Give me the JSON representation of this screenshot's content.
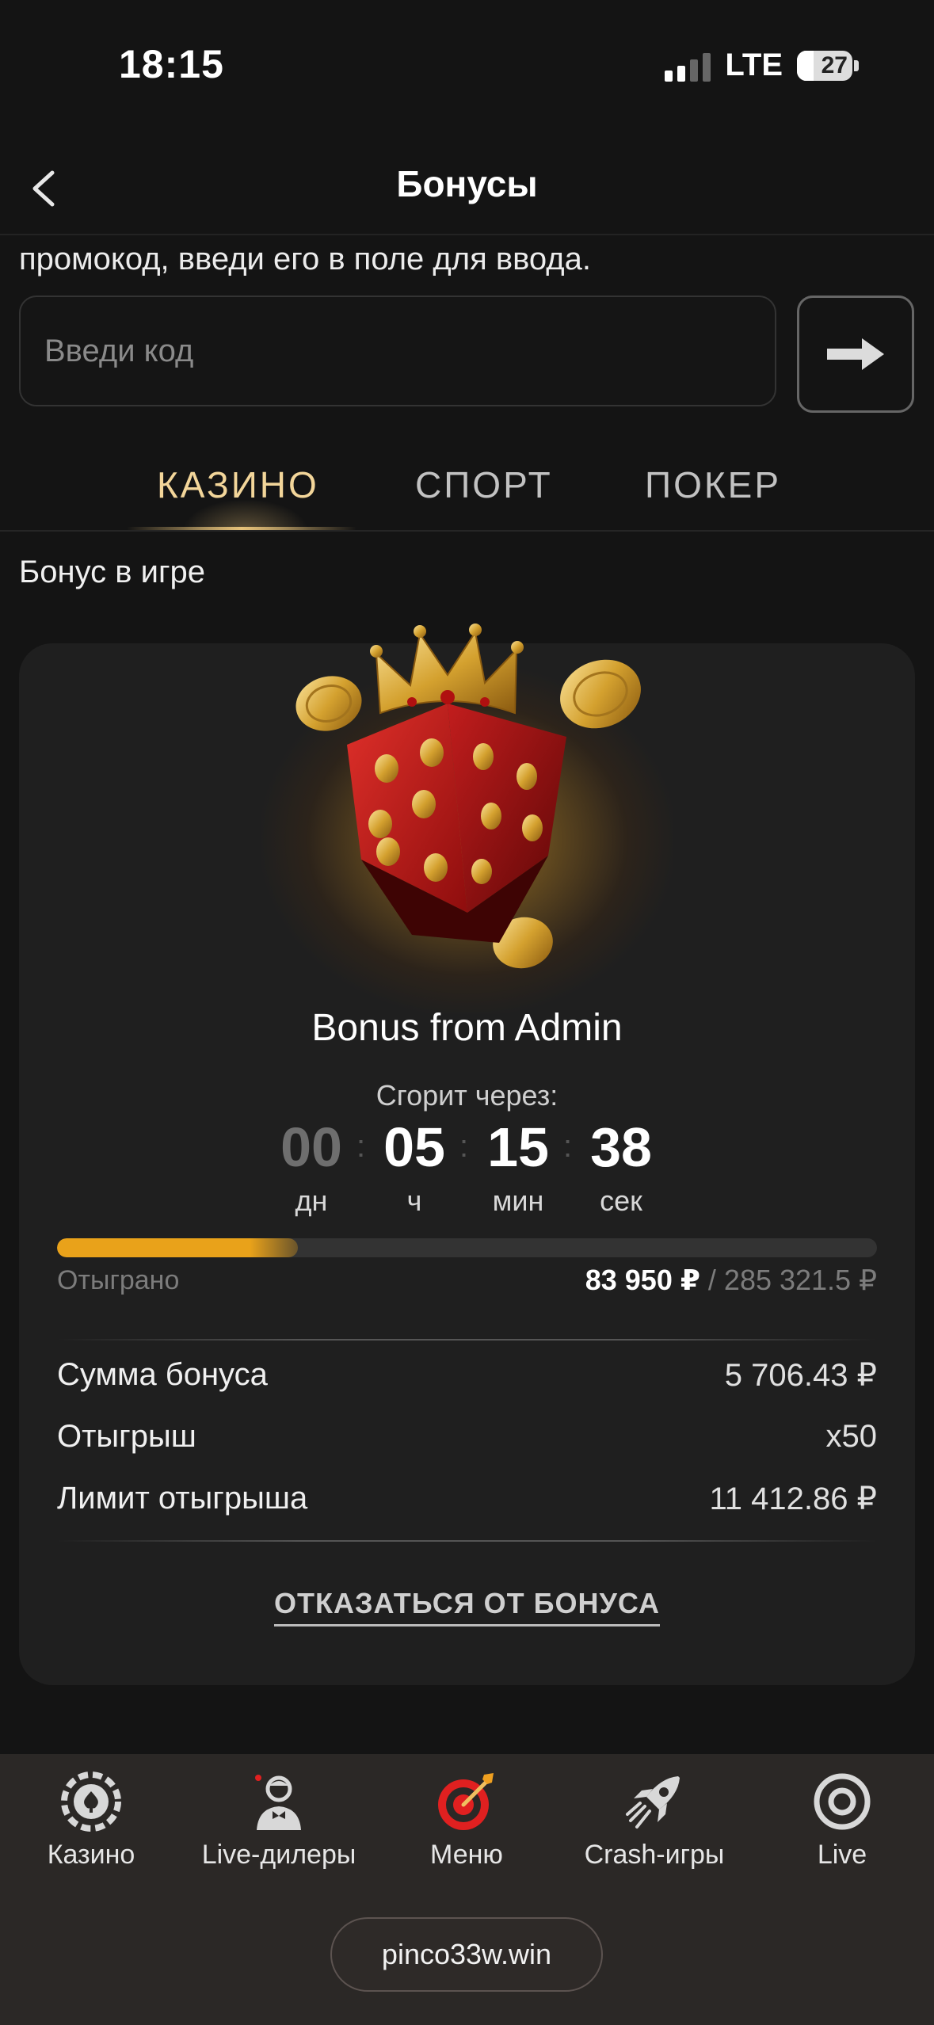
{
  "status_bar": {
    "time": "18:15",
    "network": "LTE",
    "battery": "27"
  },
  "header": {
    "title": "Бонусы"
  },
  "promo": {
    "hint": "промокод, введи его в поле для ввода.",
    "input_placeholder": "Введи код"
  },
  "tabs": [
    {
      "label": "КАЗИНО",
      "active": true
    },
    {
      "label": "СПОРТ",
      "active": false
    },
    {
      "label": "ПОКЕР",
      "active": false
    }
  ],
  "section_title": "Бонус в игре",
  "bonus": {
    "name": "Bonus from Admin",
    "expires_label": "Сгорит через:",
    "timer": {
      "days": "00",
      "hours": "05",
      "minutes": "15",
      "seconds": "38",
      "days_unit": "дн",
      "hours_unit": "ч",
      "minutes_unit": "мин",
      "seconds_unit": "сек"
    },
    "progress": {
      "fraction": 0.294,
      "label": "Отыграно",
      "current": "83 950 ₽",
      "total": "/ 285 321.5 ₽"
    },
    "details": [
      {
        "label": "Сумма бонуса",
        "value": "5 706.43 ₽"
      },
      {
        "label": "Отыгрыш",
        "value": "x50"
      },
      {
        "label": "Лимит отыгрыша",
        "value": "11 412.86 ₽"
      }
    ],
    "decline_label": "ОТКАЗАТЬСЯ ОТ БОНУСА"
  },
  "bottom_nav": [
    {
      "label": "Казино",
      "icon": "casino-chip-icon"
    },
    {
      "label": "Live-дилеры",
      "icon": "live-dealer-icon"
    },
    {
      "label": "Меню",
      "icon": "target-dart-icon"
    },
    {
      "label": "Crash-игры",
      "icon": "rocket-icon"
    },
    {
      "label": "Live",
      "icon": "live-circle-icon"
    }
  ],
  "domain": "pinco33w.win",
  "colors": {
    "accent": "#e9a21a",
    "tab_active": "#f3d69a",
    "menu_red": "#e02020"
  }
}
